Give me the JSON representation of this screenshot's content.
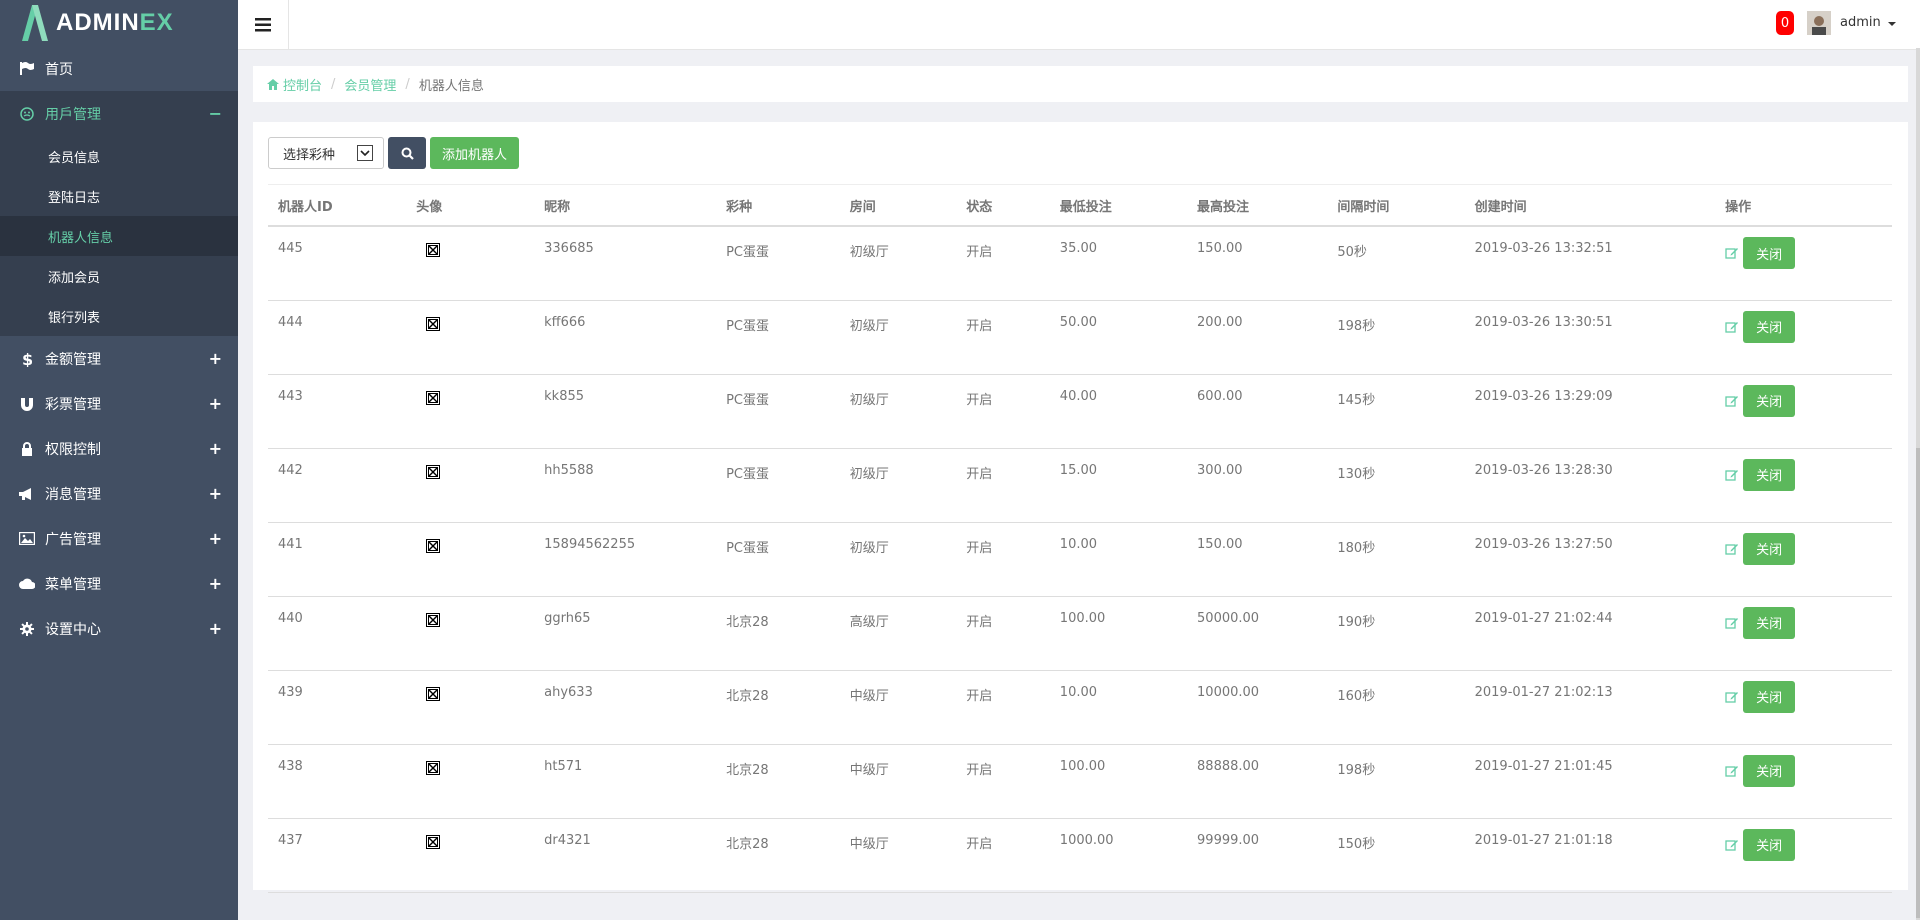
{
  "brand": {
    "prefix": "ADMIN",
    "suffix": "EX"
  },
  "sidebar": {
    "items": [
      {
        "label": "首页",
        "icon": "flag-icon",
        "toggle": ""
      },
      {
        "label": "用戶管理",
        "icon": "smile-icon",
        "toggle": "−",
        "active": true,
        "children": [
          {
            "label": "会员信息"
          },
          {
            "label": "登陆日志"
          },
          {
            "label": "机器人信息",
            "active": true
          },
          {
            "label": "添加会员"
          },
          {
            "label": "银行列表"
          }
        ]
      },
      {
        "label": "金额管理",
        "icon": "dollar-icon",
        "toggle": "+"
      },
      {
        "label": "彩票管理",
        "icon": "magnet-icon",
        "toggle": "+"
      },
      {
        "label": "权限控制",
        "icon": "lock-icon",
        "toggle": "+"
      },
      {
        "label": "消息管理",
        "icon": "bullhorn-icon",
        "toggle": "+"
      },
      {
        "label": "广告管理",
        "icon": "picture-icon",
        "toggle": "+"
      },
      {
        "label": "菜单管理",
        "icon": "cloud-icon",
        "toggle": "+"
      },
      {
        "label": "设置中心",
        "icon": "gear-icon",
        "toggle": "+"
      }
    ]
  },
  "header": {
    "notification_count": "0",
    "user_name": "admin"
  },
  "breadcrumb": {
    "home": "控制台",
    "parent": "会员管理",
    "current": "机器人信息"
  },
  "toolbar": {
    "select_value": "选择彩种",
    "add_label": "添加机器人"
  },
  "table": {
    "columns": [
      "机器人ID",
      "头像",
      "昵称",
      "彩种",
      "房间",
      "状态",
      "最低投注",
      "最高投注",
      "间隔时间",
      "创建时间",
      "操作"
    ],
    "rows": [
      {
        "id": "445",
        "nickname": "336685",
        "lottery": "PC蛋蛋",
        "room": "初级厅",
        "status": "开启",
        "min": "35.00",
        "max": "150.00",
        "interval": "50秒",
        "created": "2019-03-26 13:32:51",
        "action": "关闭"
      },
      {
        "id": "444",
        "nickname": "kff666",
        "lottery": "PC蛋蛋",
        "room": "初级厅",
        "status": "开启",
        "min": "50.00",
        "max": "200.00",
        "interval": "198秒",
        "created": "2019-03-26 13:30:51",
        "action": "关闭"
      },
      {
        "id": "443",
        "nickname": "kk855",
        "lottery": "PC蛋蛋",
        "room": "初级厅",
        "status": "开启",
        "min": "40.00",
        "max": "600.00",
        "interval": "145秒",
        "created": "2019-03-26 13:29:09",
        "action": "关闭"
      },
      {
        "id": "442",
        "nickname": "hh5588",
        "lottery": "PC蛋蛋",
        "room": "初级厅",
        "status": "开启",
        "min": "15.00",
        "max": "300.00",
        "interval": "130秒",
        "created": "2019-03-26 13:28:30",
        "action": "关闭"
      },
      {
        "id": "441",
        "nickname": "15894562255",
        "lottery": "PC蛋蛋",
        "room": "初级厅",
        "status": "开启",
        "min": "10.00",
        "max": "150.00",
        "interval": "180秒",
        "created": "2019-03-26 13:27:50",
        "action": "关闭"
      },
      {
        "id": "440",
        "nickname": "ggrh65",
        "lottery": "北京28",
        "room": "高级厅",
        "status": "开启",
        "min": "100.00",
        "max": "50000.00",
        "interval": "190秒",
        "created": "2019-01-27 21:02:44",
        "action": "关闭"
      },
      {
        "id": "439",
        "nickname": "ahy633",
        "lottery": "北京28",
        "room": "中级厅",
        "status": "开启",
        "min": "10.00",
        "max": "10000.00",
        "interval": "160秒",
        "created": "2019-01-27 21:02:13",
        "action": "关闭"
      },
      {
        "id": "438",
        "nickname": "ht571",
        "lottery": "北京28",
        "room": "中级厅",
        "status": "开启",
        "min": "100.00",
        "max": "88888.00",
        "interval": "198秒",
        "created": "2019-01-27 21:01:45",
        "action": "关闭"
      },
      {
        "id": "437",
        "nickname": "dr4321",
        "lottery": "北京28",
        "room": "中级厅",
        "status": "开启",
        "min": "1000.00",
        "max": "99999.00",
        "interval": "150秒",
        "created": "2019-01-27 21:01:18",
        "action": "关闭"
      }
    ]
  },
  "colors": {
    "sidebar_bg": "#424f63",
    "accent": "#65cea7",
    "success": "#5cb85c",
    "badge": "#ff0000"
  }
}
